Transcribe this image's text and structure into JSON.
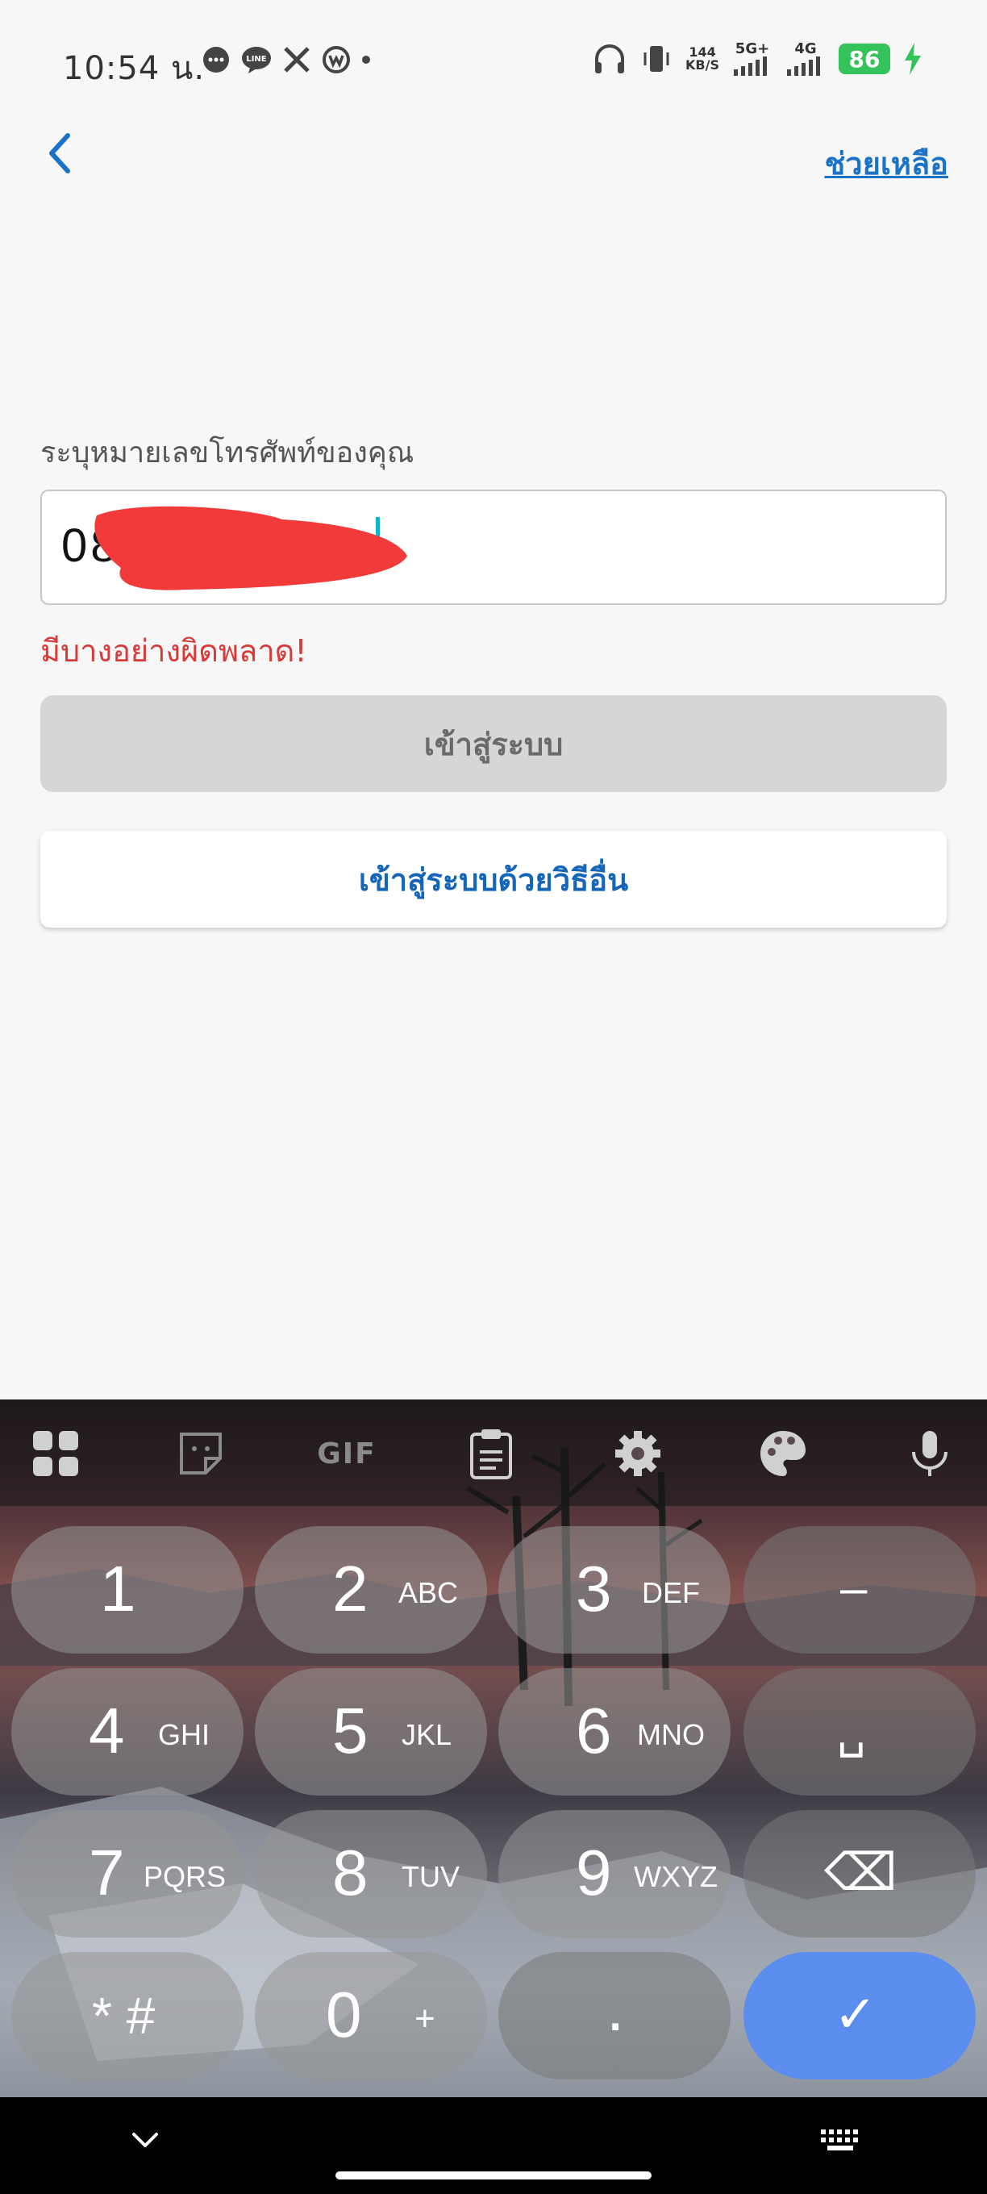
{
  "status_bar": {
    "time": "10:54 น.",
    "net_speed_value": "144",
    "net_speed_unit": "KB/S",
    "network_1": "5G+",
    "network_2": "4G",
    "battery_level": "86",
    "icons": [
      "message-icon",
      "line-icon",
      "x-icon",
      "wavve-icon",
      "dot-icon",
      "headphones-icon",
      "vibrate-icon",
      "signal-icon",
      "battery-icon",
      "charging-icon"
    ]
  },
  "header": {
    "back_icon": "chevron-left-icon",
    "help_label": "ช่วยเหลือ"
  },
  "form": {
    "phone_label": "ระบุหมายเลขโทรศัพท์ของคุณ",
    "phone_value": "08        27",
    "error_message": "มีบางอย่างผิดพลาด!",
    "login_label": "เข้าสู่ระบบ",
    "other_login_label": "เข้าสู่ระบบด้วยวิธีอื่น"
  },
  "keyboard": {
    "toolbar": [
      "apps-icon",
      "sticker-icon",
      "GIF",
      "clipboard-icon",
      "gear-icon",
      "palette-icon",
      "mic-icon"
    ],
    "keys": [
      {
        "digit": "1",
        "letters": ""
      },
      {
        "digit": "2",
        "letters": "ABC"
      },
      {
        "digit": "3",
        "letters": "DEF"
      },
      {
        "digit": "–",
        "letters": ""
      },
      {
        "digit": "4",
        "letters": "GHI"
      },
      {
        "digit": "5",
        "letters": "JKL"
      },
      {
        "digit": "6",
        "letters": "MNO"
      },
      {
        "digit": "␣",
        "letters": ""
      },
      {
        "digit": "7",
        "letters": "PQRS"
      },
      {
        "digit": "8",
        "letters": "TUV"
      },
      {
        "digit": "9",
        "letters": "WXYZ"
      },
      {
        "digit": "⌫",
        "letters": ""
      },
      {
        "digit": "* #",
        "letters": ""
      },
      {
        "digit": "0",
        "letters": "+"
      },
      {
        "digit": ".",
        "letters": ""
      },
      {
        "digit": "✓",
        "letters": ""
      }
    ]
  },
  "colors": {
    "accent": "#1a73c8",
    "error": "#d83a3a",
    "battery": "#33c35a",
    "confirm_key": "#5b8def"
  }
}
